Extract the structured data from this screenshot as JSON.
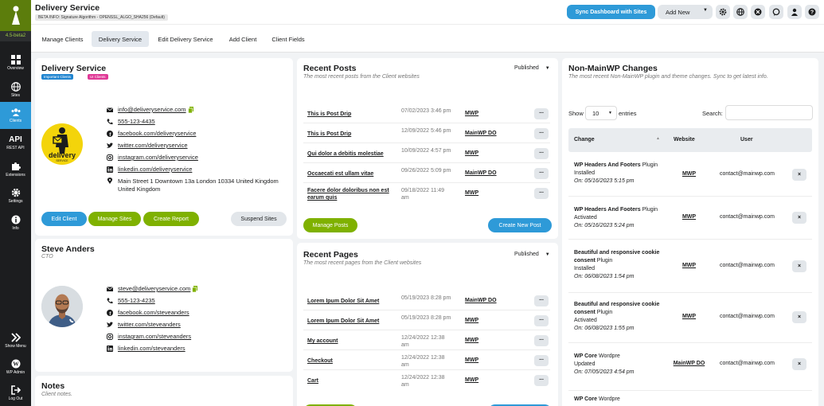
{
  "sidebar": {
    "version": "4.5-beta2",
    "items": [
      {
        "label": "Overview"
      },
      {
        "label": "Sites"
      },
      {
        "label": "Clients"
      },
      {
        "label": "REST API",
        "big": "API"
      },
      {
        "label": "Extensions"
      },
      {
        "label": "Settings"
      },
      {
        "label": "Info"
      }
    ],
    "bottom": [
      {
        "label": "Show Menu"
      },
      {
        "label": "WP Admin"
      },
      {
        "label": "Log Out"
      }
    ]
  },
  "header": {
    "title": "Delivery Service",
    "beta": "BETA INFO: Signature Algorithm - OPENSSL_ALGO_SHA256 (Default)",
    "sync": "Sync Dashboard with Sites",
    "add_new": "Add New"
  },
  "tabs": [
    "Manage Clients",
    "Delivery Service",
    "Edit Delivery Service",
    "Add Client",
    "Client Fields"
  ],
  "client": {
    "name": "Delivery Service",
    "tags": [
      "Important Clients",
      "UI Clients"
    ],
    "email": "info@deliveryservice.com",
    "phone": "555-123-4435",
    "facebook": "facebook.com/deliveryservice",
    "twitter": "twitter.com/deliveryservice",
    "instagram": "instagram.com/deliveryservice",
    "linkedin": "linkedin.com/deliveryservice",
    "address": "Main Street 1 Downtown 13a London 10334 United Kingdom United Kingdom",
    "logo_text": "delivery",
    "logo_sub": "SERVICE",
    "buttons": {
      "edit": "Edit Client",
      "sites": "Manage Sites",
      "report": "Create Report",
      "suspend": "Suspend Sites"
    }
  },
  "contact": {
    "name": "Steve Anders",
    "role": "CTO",
    "email": "steve@deliveryservice.com",
    "phone": "555-123-4235",
    "facebook": "facebook.com/steveanders",
    "twitter": "twitter.com/steveanders",
    "instagram": "instagram.com/steveanders",
    "linkedin": "linkedin.com/steveanders"
  },
  "notes": {
    "title": "Notes",
    "sub": "Client notes."
  },
  "recent_posts": {
    "title": "Recent Posts",
    "sub": "The most recent posts from the Client websites",
    "filter": "Published",
    "rows": [
      {
        "title": "This is Post Drip",
        "date": "07/02/2023 3:46 pm",
        "site": "MWP"
      },
      {
        "title": "This is Post Drip",
        "date": "12/09/2022 5:46 pm",
        "site": "MainWP DO"
      },
      {
        "title": "Qui dolor a debitis molestiae",
        "date": "10/09/2022 4:57 pm",
        "site": "MWP"
      },
      {
        "title": "Occaecati est ullam vitae",
        "date": "09/26/2022 5:09 pm",
        "site": "MainWP DO"
      },
      {
        "title": "Facere dolor doloribus non est earum quis",
        "date": "09/18/2022 11:49 am",
        "site": "MWP"
      }
    ],
    "manage": "Manage Posts",
    "create": "Create New Post"
  },
  "recent_pages": {
    "title": "Recent Pages",
    "sub": "The most recent pages from the Client websites",
    "filter": "Published",
    "rows": [
      {
        "title": "Lorem Ipum Dolor Sit Amet",
        "date": "05/19/2023 8:28 pm",
        "site": "MainWP DO"
      },
      {
        "title": "Lorem Ipum Dolor Sit Amet",
        "date": "05/19/2023 8:28 pm",
        "site": "MWP"
      },
      {
        "title": "My account",
        "date": "12/24/2022 12:38 am",
        "site": "MWP"
      },
      {
        "title": "Checkout",
        "date": "12/24/2022 12:38 am",
        "site": "MWP"
      },
      {
        "title": "Cart",
        "date": "12/24/2022 12:38 am",
        "site": "MWP"
      }
    ]
  },
  "changes": {
    "title": "Non-MainWP Changes",
    "sub": "The most recent Non-MainWP plugin and theme changes. Sync to get latest info.",
    "show": "Show",
    "show_val": "10",
    "entries": "entries",
    "search": "Search:",
    "cols": [
      "Change",
      "Website",
      "User"
    ],
    "rows": [
      {
        "name": "WP Headers And Footers",
        "kind": "Plugin",
        "action": "Installed",
        "date": "On: 05/16/2023 5:15 pm",
        "site": "MWP",
        "user": "contact@mainwp.com"
      },
      {
        "name": "WP Headers And Footers",
        "kind": "Plugin",
        "action": "Activated",
        "date": "On: 05/16/2023 5:24 pm",
        "site": "MWP",
        "user": "contact@mainwp.com"
      },
      {
        "name": "Beautiful and responsive cookie consent",
        "kind": "Plugin",
        "action": "Installed",
        "date": "On: 06/08/2023 1:54 pm",
        "site": "MWP",
        "user": "contact@mainwp.com"
      },
      {
        "name": "Beautiful and responsive cookie consent",
        "kind": "Plugin",
        "action": "Activated",
        "date": "On: 06/08/2023 1:55 pm",
        "site": "MWP",
        "user": "contact@mainwp.com"
      },
      {
        "name": "WP Core",
        "kind": "Wordpre",
        "action": "Updated",
        "date": "On: 07/05/2023 4:54 pm",
        "site": "MainWP DO",
        "user": "contact@mainwp.com"
      },
      {
        "name": "WP Core",
        "kind": "Wordpre",
        "action": "",
        "date": "",
        "site": "",
        "user": ""
      }
    ]
  },
  "colors": {
    "blue": "#2e9ad8",
    "green": "#7fb100",
    "sidebar": "#1c1d1f",
    "tag_blue": "#2185d0",
    "tag_pink": "#e03997",
    "logo_yellow": "#f3d40b"
  }
}
